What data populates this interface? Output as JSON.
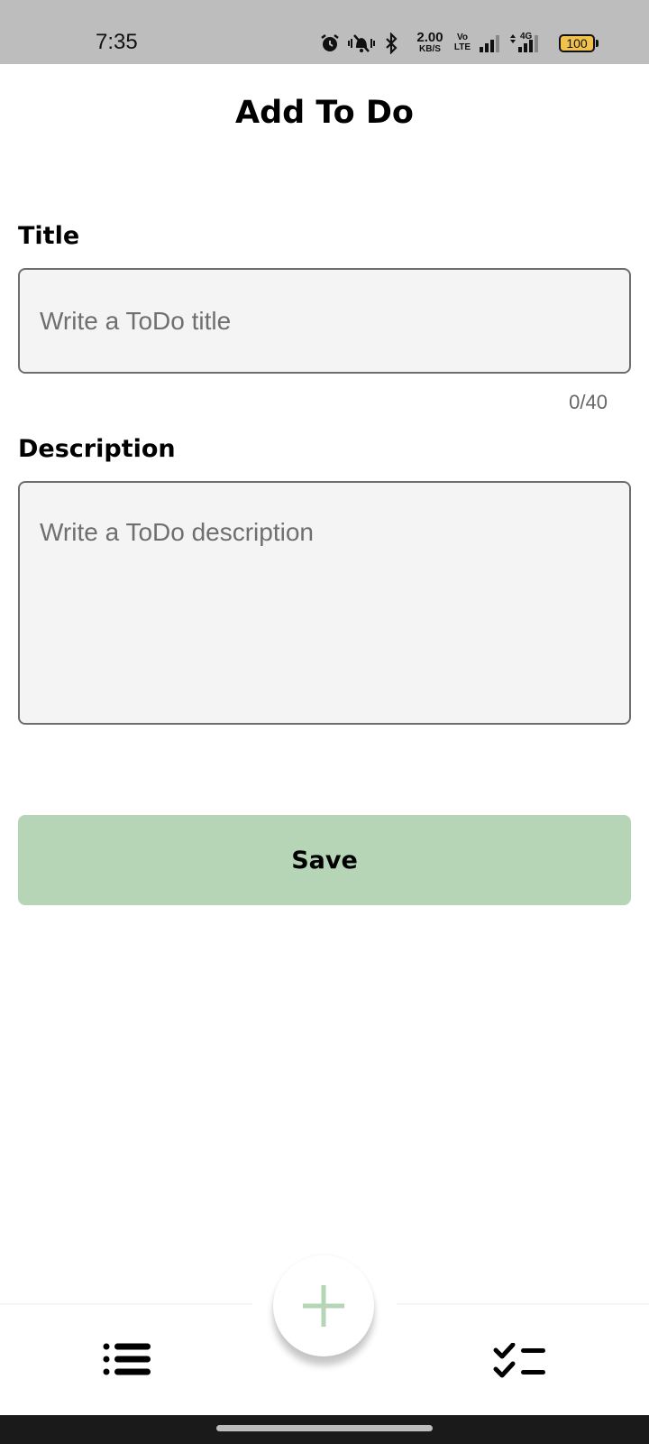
{
  "status_bar": {
    "time": "7:35",
    "net_speed_value": "2.00",
    "net_speed_unit": "KB/S",
    "volte_top": "Vo",
    "volte_bottom": "LTE",
    "network_type": "4G",
    "battery_level": "100",
    "icons": [
      "alarm-icon",
      "vibrate-icon",
      "bluetooth-icon",
      "signal-icon",
      "battery-icon"
    ]
  },
  "header": {
    "title": "Add To Do"
  },
  "form": {
    "title_label": "Title",
    "title_placeholder": "Write a ToDo title",
    "title_value": "",
    "title_counter": "0/40",
    "description_label": "Description",
    "description_placeholder": "Write a ToDo description",
    "description_value": "",
    "save_label": "Save"
  },
  "bottom_nav": {
    "items": [
      {
        "icon": "list-icon"
      },
      {
        "icon": "add-icon"
      },
      {
        "icon": "completed-list-icon"
      }
    ]
  },
  "colors": {
    "accent": "#b6d4b6",
    "fab_plus": "#b6d4b6",
    "input_bg": "#f4f4f4",
    "status_bar": "#bdbdbd",
    "battery": "#f0c14b"
  }
}
